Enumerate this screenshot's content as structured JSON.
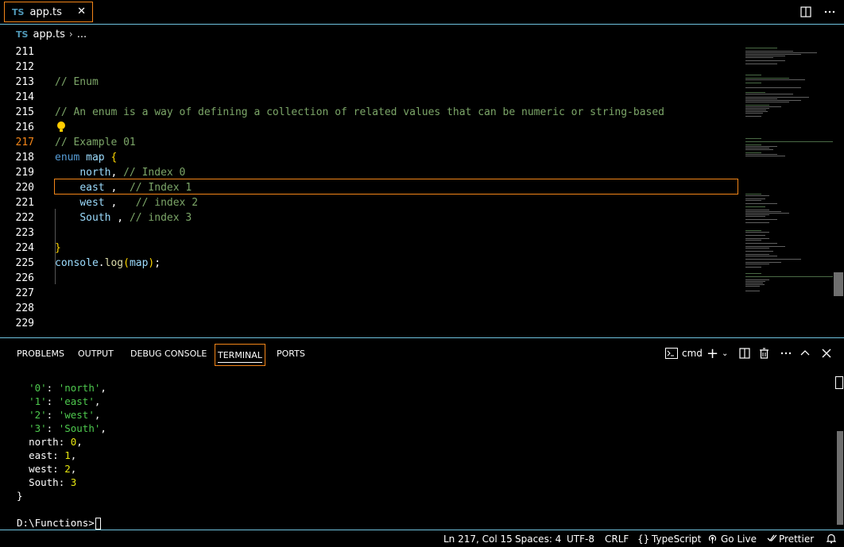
{
  "tabs": [
    {
      "icon": "TS",
      "label": "app.ts",
      "close": "✕"
    }
  ],
  "breadcrumb": {
    "icon": "TS",
    "file": "app.ts",
    "separator": "›",
    "more": "..."
  },
  "editor": {
    "active_line": 217,
    "lines": [
      {
        "n": "211",
        "code": ""
      },
      {
        "n": "212",
        "code": ""
      },
      {
        "n": "213",
        "code": "// Enum"
      },
      {
        "n": "214",
        "code": ""
      },
      {
        "n": "215",
        "code": "// An enum is a way of defining a collection of related values that can be numeric or string-based"
      },
      {
        "n": "216",
        "code": ""
      },
      {
        "n": "217",
        "code": "// Example 01"
      },
      {
        "n": "218",
        "code": "enum map {"
      },
      {
        "n": "219",
        "code": "    north, // Index 0"
      },
      {
        "n": "220",
        "code": "    east ,  // Index 1"
      },
      {
        "n": "221",
        "code": "    west ,   // index 2"
      },
      {
        "n": "222",
        "code": "    South , // index 3"
      },
      {
        "n": "223",
        "code": ""
      },
      {
        "n": "224",
        "code": "}"
      },
      {
        "n": "225",
        "code": "console.log(map);"
      },
      {
        "n": "226",
        "code": ""
      },
      {
        "n": "227",
        "code": ""
      },
      {
        "n": "228",
        "code": ""
      },
      {
        "n": "229",
        "code": ""
      }
    ]
  },
  "panel": {
    "tabs": [
      "PROBLEMS",
      "OUTPUT",
      "DEBUG CONSOLE",
      "TERMINAL",
      "PORTS"
    ],
    "active_tab": "TERMINAL",
    "terminal_name": "cmd",
    "output": {
      "s0": "'0'",
      "v0": "'north'",
      "s1": "'1'",
      "v1": "'east'",
      "s2": "'2'",
      "v2": "'west'",
      "s3": "'3'",
      "v3": "'South'",
      "k4": "north",
      "n4": "0",
      "k5": "east",
      "n5": "1",
      "k6": "west",
      "n6": "2",
      "k7": "South",
      "n7": "3",
      "close": "}",
      "prompt": "D:\\Functions>"
    }
  },
  "statusbar": {
    "position": "Ln 217, Col 15",
    "spaces": "Spaces: 4",
    "encoding": "UTF-8",
    "eol": "CRLF",
    "language_icon": "{}",
    "language": "TypeScript",
    "golive": "Go Live",
    "prettier": "Prettier"
  },
  "colors": {
    "focus_border": "#f38518",
    "panel_border": "#6fc3df",
    "comment": "#7ca668",
    "keyword": "#569cd6",
    "identifier": "#9cdcfe",
    "string": "#4ec94e",
    "number": "#e5e510"
  }
}
